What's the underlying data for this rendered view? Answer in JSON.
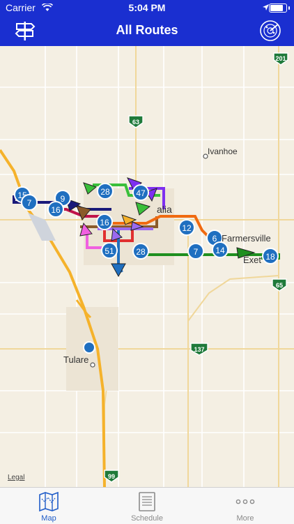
{
  "status_bar": {
    "carrier": "Carrier",
    "time": "5:04 PM"
  },
  "nav": {
    "title": "All Routes",
    "left_icon": "signpost-icon",
    "right_icon": "radar-icon"
  },
  "map": {
    "places": {
      "ivanhoe": "Ivanhoe",
      "visalia": "alia",
      "farmersville": "Farmersville",
      "exeter": "Exet",
      "tulare": "Tulare"
    },
    "highways": {
      "h201": "201",
      "h63": "63",
      "h65": "65",
      "h137": "137",
      "h99": "99"
    },
    "route_badges": [
      "15",
      "7",
      "9",
      "16",
      "28",
      "47",
      "16",
      "12",
      "6",
      "51",
      "28",
      "7",
      "14",
      "18"
    ],
    "legal": "Legal"
  },
  "tabs": [
    {
      "label": "Map",
      "icon": "map-icon",
      "selected": true
    },
    {
      "label": "Schedule",
      "icon": "schedule-icon",
      "selected": false
    },
    {
      "label": "More",
      "icon": "more-icon",
      "selected": false
    }
  ],
  "colors": {
    "nav": "#1a2fd0",
    "badge": "#1f6fc0",
    "tab_active": "#1f5cc8",
    "tab_inactive": "#8a8a8a"
  }
}
